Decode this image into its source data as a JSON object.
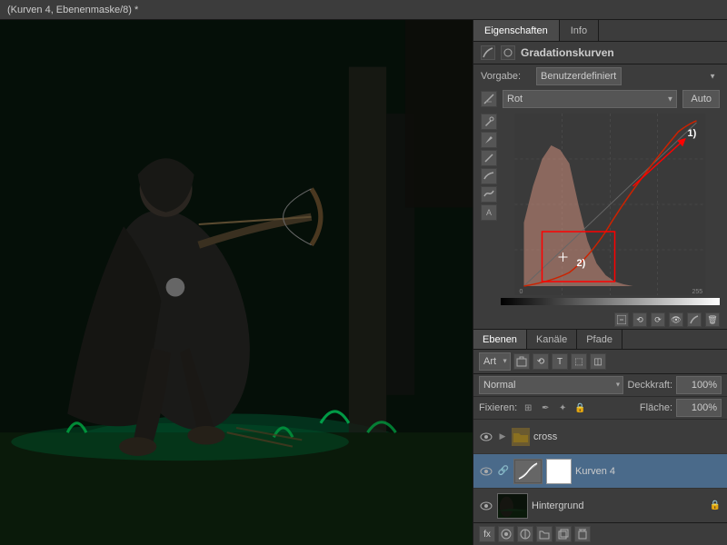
{
  "titleBar": {
    "text": "(Kurven 4, Ebenenmaske/8) *"
  },
  "panelTabs": [
    {
      "id": "eigenschaften",
      "label": "Eigenschaften",
      "active": true
    },
    {
      "id": "info",
      "label": "Info",
      "active": false
    }
  ],
  "curvesPanel": {
    "title": "Gradationskurven",
    "vorgabeLabel": "Vorgabe:",
    "vorgabeValue": "Benutzerdefiniert",
    "channelValue": "Rot",
    "autoLabel": "Auto",
    "annotation1": "1)",
    "annotation2": "2)"
  },
  "layersTabs": [
    {
      "id": "ebenen",
      "label": "Ebenen",
      "active": true
    },
    {
      "id": "kanaele",
      "label": "Kanäle",
      "active": false
    },
    {
      "id": "pfade",
      "label": "Pfade",
      "active": false
    }
  ],
  "blendRow": {
    "modeValue": "Normal",
    "opacityLabel": "Deckkraft:",
    "opacityValue": "100%",
    "fixLabel": "Fixieren:",
    "flaecheLabel": "Fläche:",
    "flaecheValue": "100%"
  },
  "layers": [
    {
      "id": "cross",
      "name": "cross",
      "type": "folder",
      "visible": true,
      "expanded": false,
      "active": false,
      "indent": 0
    },
    {
      "id": "kurven4",
      "name": "Kurven 4",
      "type": "adjustment",
      "visible": true,
      "expanded": false,
      "active": true,
      "indent": 1
    },
    {
      "id": "hintergrund",
      "name": "Hintergrund",
      "type": "background",
      "visible": true,
      "expanded": false,
      "active": false,
      "indent": 0
    }
  ],
  "icons": {
    "eye": "👁",
    "eyeOff": "○",
    "folder": "📁",
    "lock": "🔒",
    "chain": "🔗",
    "expand": "▶",
    "collapse": "▼",
    "curves": "~",
    "tool_eyedropper": "✒",
    "tool_point": "⊕",
    "tool_line": "╱",
    "tool_curve": "∿",
    "tool_text": "T",
    "tool_select": "⊙",
    "tool_mask": "⊡"
  },
  "bottomIcons": [
    "↻",
    "⊕",
    "⊡",
    "◫",
    "⬚",
    "🗑"
  ]
}
